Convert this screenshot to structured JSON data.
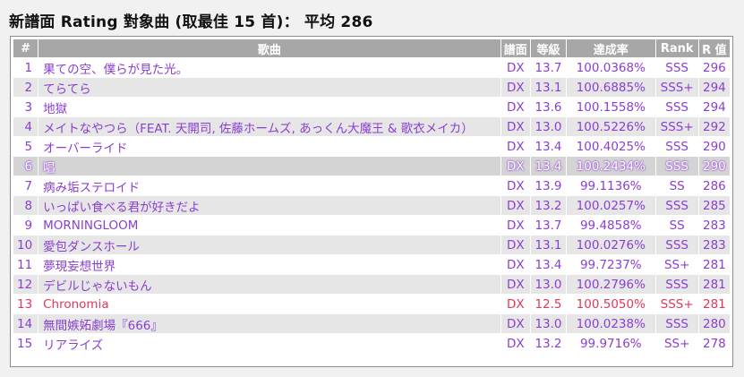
{
  "title": "新譜面 Rating 對象曲 (取最佳 15 首)： 平均 286",
  "headers": {
    "index": "#",
    "song": "歌曲",
    "chart": "譜面",
    "level": "等級",
    "achievement": "達成率",
    "rank": "Rank",
    "rating": "R 值"
  },
  "rows": [
    {
      "index": "1",
      "song": "果ての空、僕らが見た光。",
      "chart": "DX",
      "level": "13.7",
      "achievement": "100.0368%",
      "rank": "SSS",
      "rating": "296"
    },
    {
      "index": "2",
      "song": "てらてら",
      "chart": "DX",
      "level": "13.1",
      "achievement": "100.6885%",
      "rank": "SSS+",
      "rating": "294"
    },
    {
      "index": "3",
      "song": "地獄",
      "chart": "DX",
      "level": "13.6",
      "achievement": "100.1558%",
      "rank": "SSS",
      "rating": "294"
    },
    {
      "index": "4",
      "song": "メイトなやつら（FEAT. 天開司, 佐藤ホームズ, あっくん大魔王 & 歌衣メイカ）",
      "chart": "DX",
      "level": "13.0",
      "achievement": "100.5226%",
      "rank": "SSS+",
      "rating": "292"
    },
    {
      "index": "5",
      "song": "オーバーライド",
      "chart": "DX",
      "level": "13.4",
      "achievement": "100.4025%",
      "rank": "SSS",
      "rating": "290"
    },
    {
      "index": "6",
      "song": "唱",
      "chart": "DX",
      "level": "13.4",
      "achievement": "100.2434%",
      "rank": "SSS",
      "rating": "290"
    },
    {
      "index": "7",
      "song": "病み垢ステロイド",
      "chart": "DX",
      "level": "13.9",
      "achievement": "99.1136%",
      "rank": "SS",
      "rating": "286"
    },
    {
      "index": "8",
      "song": "いっぱい食べる君が好きだよ",
      "chart": "DX",
      "level": "13.2",
      "achievement": "100.0257%",
      "rank": "SSS",
      "rating": "285"
    },
    {
      "index": "9",
      "song": "MORNINGLOOM",
      "chart": "DX",
      "level": "13.7",
      "achievement": "99.4858%",
      "rank": "SS",
      "rating": "283"
    },
    {
      "index": "10",
      "song": "愛包ダンスホール",
      "chart": "DX",
      "level": "13.1",
      "achievement": "100.0276%",
      "rank": "SSS",
      "rating": "283"
    },
    {
      "index": "11",
      "song": "夢現妄想世界",
      "chart": "DX",
      "level": "13.4",
      "achievement": "99.7237%",
      "rank": "SS+",
      "rating": "281"
    },
    {
      "index": "12",
      "song": "デビルじゃないもん",
      "chart": "DX",
      "level": "13.0",
      "achievement": "100.2796%",
      "rank": "SSS",
      "rating": "281"
    },
    {
      "index": "13",
      "song": "Chronomia",
      "chart": "DX",
      "level": "12.5",
      "achievement": "100.5050%",
      "rank": "SSS+",
      "rating": "281"
    },
    {
      "index": "14",
      "song": "無間嫉妬劇場『666』",
      "chart": "DX",
      "level": "13.0",
      "achievement": "100.0238%",
      "rank": "SSS",
      "rating": "280"
    },
    {
      "index": "15",
      "song": "リアライズ",
      "chart": "DX",
      "level": "13.2",
      "achievement": "99.9716%",
      "rank": "SS+",
      "rating": "278"
    }
  ],
  "highlighted_row": 6,
  "red_row": 13,
  "colors": {
    "text_purple": "#8a3fd0",
    "text_red": "#e0385a",
    "header_bg": "#a7a7a7",
    "row_alt_bg": "#e6e6e6",
    "row_highlight_bg": "#d4d4d4"
  }
}
